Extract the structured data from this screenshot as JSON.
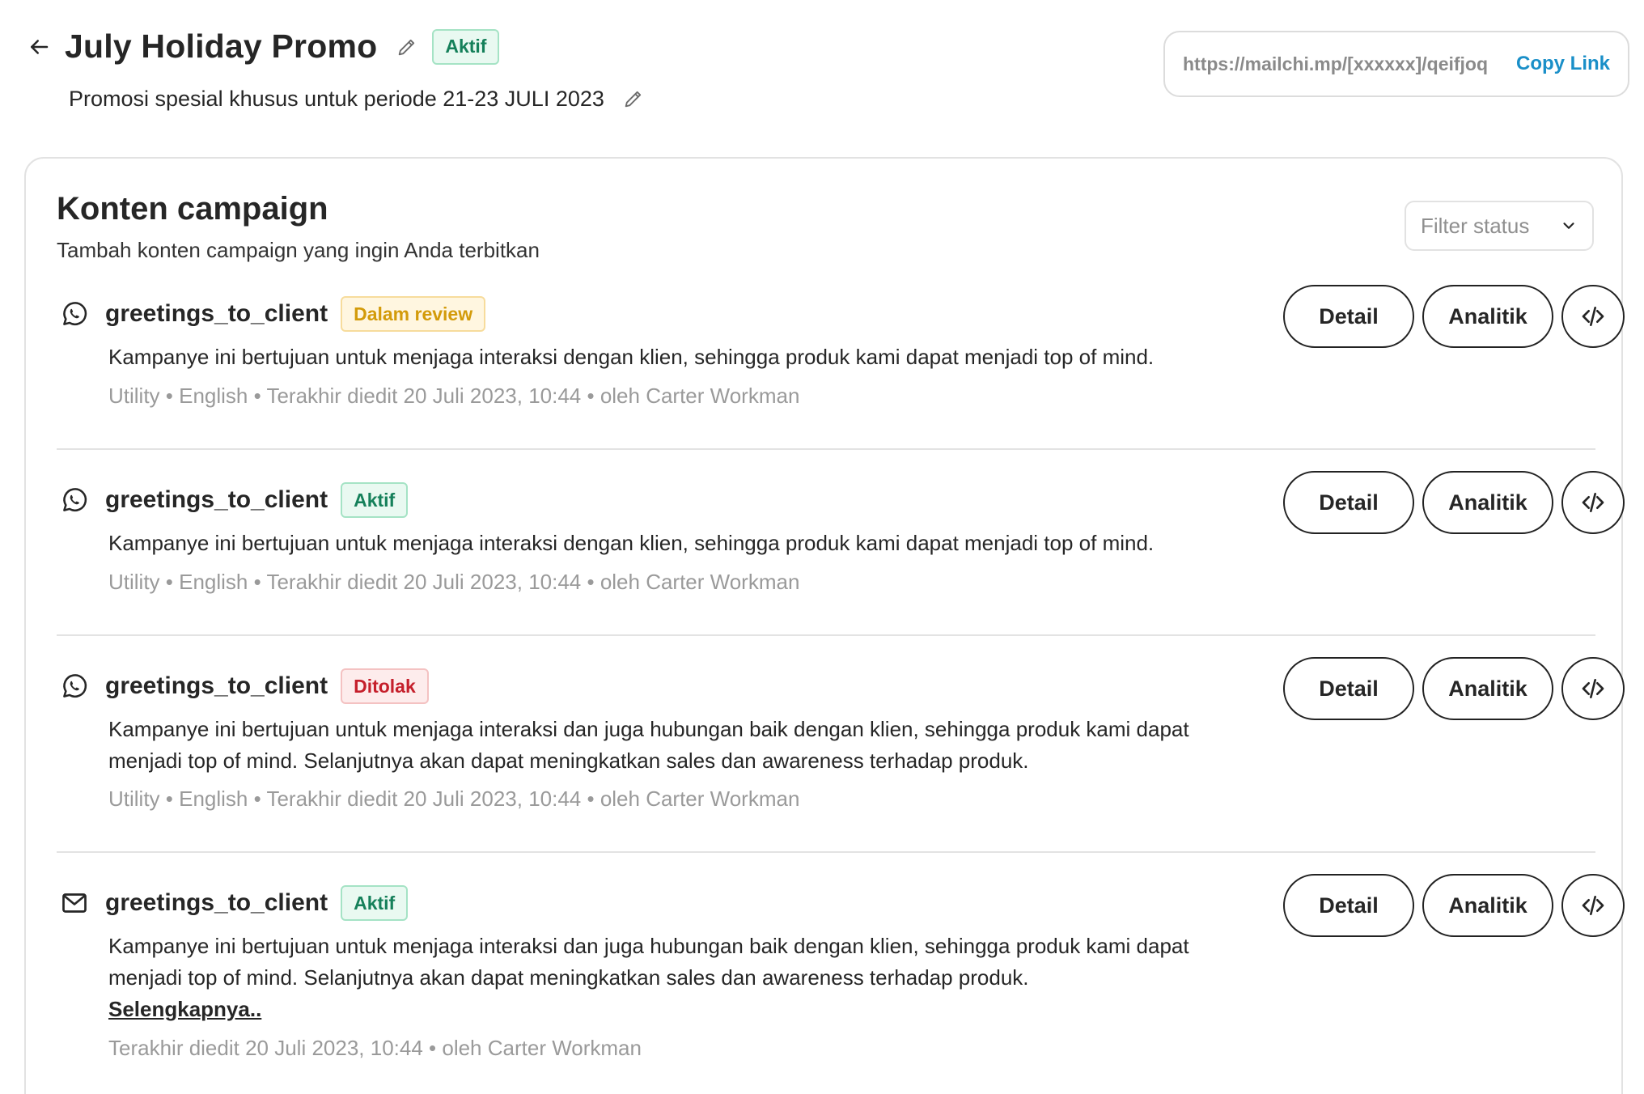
{
  "header": {
    "title": "July Holiday Promo",
    "status": "Aktif",
    "subtitle": "Promosi spesial khusus untuk periode 21-23 JULI 2023",
    "link_url": "https://mailchi.mp/[xxxxxx]/qeifjoq",
    "copy_label": "Copy Link"
  },
  "content": {
    "title": "Konten campaign",
    "description": "Tambah konten campaign yang ingin Anda terbitkan",
    "filter_placeholder": "Filter status",
    "detail_label": "Detail",
    "analytics_label": "Analitik",
    "items": [
      {
        "channel_icon": "whatsapp-icon",
        "name": "greetings_to_client",
        "status": "Dalam review",
        "body": "Kampanye ini bertujuan untuk menjaga interaksi dengan klien, sehingga produk kami dapat menjadi top of mind.",
        "meta": "Utility  • English • Terakhir diedit 20 Juli 2023, 10:44 • oleh Carter Workman"
      },
      {
        "channel_icon": "whatsapp-icon",
        "name": "greetings_to_client",
        "status": "Aktif",
        "body": "Kampanye ini bertujuan untuk menjaga interaksi dengan klien, sehingga produk kami dapat menjadi top of mind.",
        "meta": "Utility  • English • Terakhir diedit 20 Juli 2023, 10:44 • oleh Carter Workman"
      },
      {
        "channel_icon": "whatsapp-icon",
        "name": "greetings_to_client",
        "status": "Ditolak",
        "body": "Kampanye ini bertujuan untuk menjaga interaksi dan juga hubungan baik dengan klien, sehingga produk kami dapat menjadi top of mind. Selanjutnya akan dapat meningkatkan sales dan awareness terhadap produk.",
        "meta": "Utility  • English • Terakhir diedit 20 Juli 2023, 10:44 • oleh Carter Workman"
      },
      {
        "channel_icon": "email-icon",
        "name": "greetings_to_client",
        "status": "Aktif",
        "body": "Kampanye ini bertujuan untuk menjaga interaksi dan juga hubungan baik dengan klien, sehingga produk kami dapat menjadi top of mind. Selanjutnya akan dapat meningkatkan sales dan awareness terhadap produk.",
        "more_label": "Selengkapnya..",
        "meta": "Terakhir diedit 20 Juli 2023, 10:44 • oleh Carter Workman"
      }
    ]
  },
  "colors": {
    "active_text": "#15805a",
    "review_text": "#d39b0a",
    "rejected_text": "#c51f2b",
    "link": "#1a8fc8"
  }
}
